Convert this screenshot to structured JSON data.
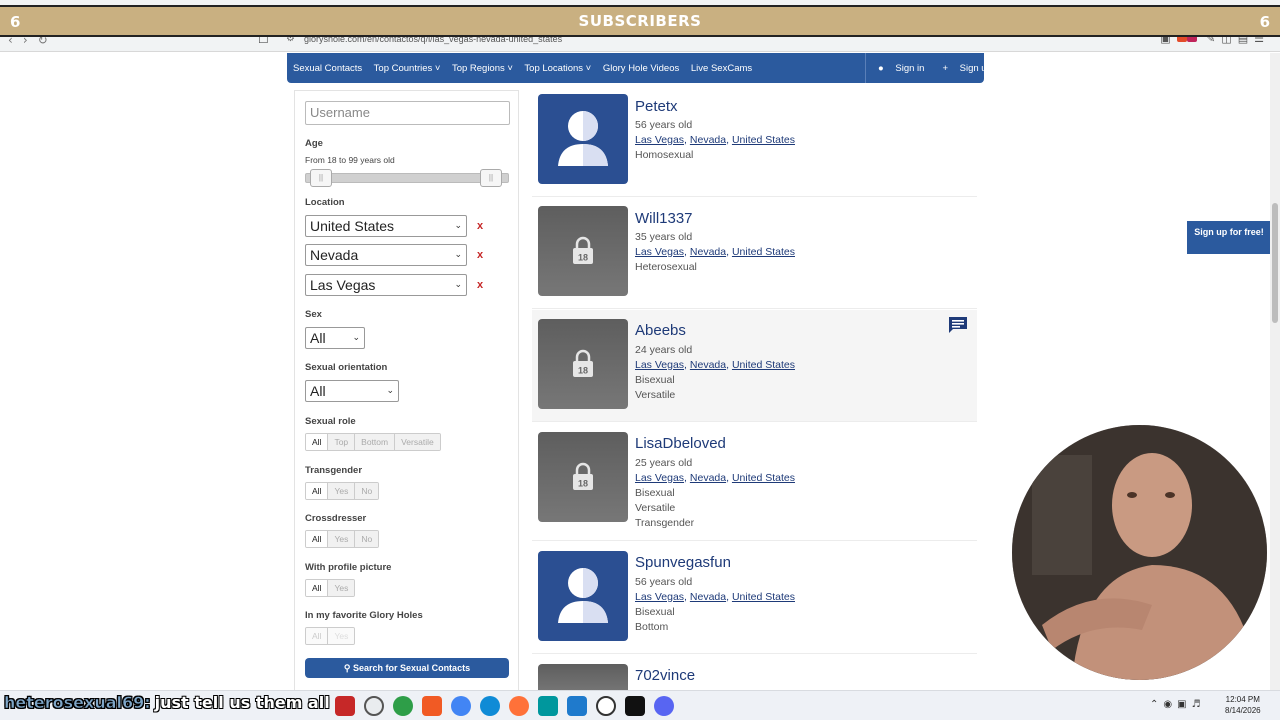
{
  "browser": {
    "url": "gloryshole.com/en/contactos/q/l/las_vegas-nevada-united_states"
  },
  "overlay": {
    "title": "SUBSCRIBERS",
    "count_left": "6",
    "count_right": "6"
  },
  "nav": {
    "links": [
      "Sexual Contacts",
      "Top Countries ˅",
      "Top Regions ˅",
      "Top Locations ˅",
      "Glory Hole Videos",
      "Live SexCams"
    ],
    "sign_in": "Sign in",
    "sign_up": "Sign up"
  },
  "filters": {
    "username_placeholder": "Username",
    "age_label": "Age",
    "age_range": "From 18 to 99 years old",
    "age_min": 18,
    "age_max": 99,
    "location_label": "Location",
    "country": "United States",
    "region": "Nevada",
    "city": "Las Vegas",
    "remove": "x",
    "sex_label": "Sex",
    "sex_value": "All",
    "orientation_label": "Sexual orientation",
    "orientation_value": "All",
    "role_label": "Sexual role",
    "role_options": [
      "All",
      "Top",
      "Bottom",
      "Versatile"
    ],
    "transgender_label": "Transgender",
    "transgender_options": [
      "All",
      "Yes",
      "No"
    ],
    "crossdresser_label": "Crossdresser",
    "crossdresser_options": [
      "All",
      "Yes",
      "No"
    ],
    "picture_label": "With profile picture",
    "picture_options": [
      "All",
      "Yes"
    ],
    "favorite_label": "In my favorite Glory Holes",
    "favorite_options": [
      "All",
      "Yes"
    ],
    "search_button": "Search for Sexual Contacts"
  },
  "results": [
    {
      "name": "Petetx",
      "age": "56 years old",
      "city": "Las Vegas",
      "region": "Nevada",
      "country": "United States",
      "details": [
        "Homosexual"
      ]
    },
    {
      "name": "Will1337",
      "age": "35 years old",
      "city": "Las Vegas",
      "region": "Nevada",
      "country": "United States",
      "details": [
        "Heterosexual"
      ]
    },
    {
      "name": "Abeebs",
      "age": "24 years old",
      "city": "Las Vegas",
      "region": "Nevada",
      "country": "United States",
      "details": [
        "Bisexual",
        "Versatile"
      ]
    },
    {
      "name": "LisaDbeloved",
      "age": "25 years old",
      "city": "Las Vegas",
      "region": "Nevada",
      "country": "United States",
      "details": [
        "Bisexual",
        "Versatile",
        "Transgender"
      ]
    },
    {
      "name": "Spunvegasfun",
      "age": "56 years old",
      "city": "Las Vegas",
      "region": "Nevada",
      "country": "United States",
      "details": [
        "Bisexual",
        "Bottom"
      ]
    },
    {
      "name": "702vince"
    }
  ],
  "sep": ",",
  "badge_18": "18",
  "side_signup": "Sign up for free!",
  "chat": {
    "user": "heterosexual69:",
    "message": "just tell us them all"
  },
  "clock": {
    "time": "12:04 PM",
    "date": "8/14/2026"
  },
  "colors": {
    "nav_blue": "#2b5a9e",
    "banner": "#c9b081",
    "link": "#1e3a78"
  }
}
